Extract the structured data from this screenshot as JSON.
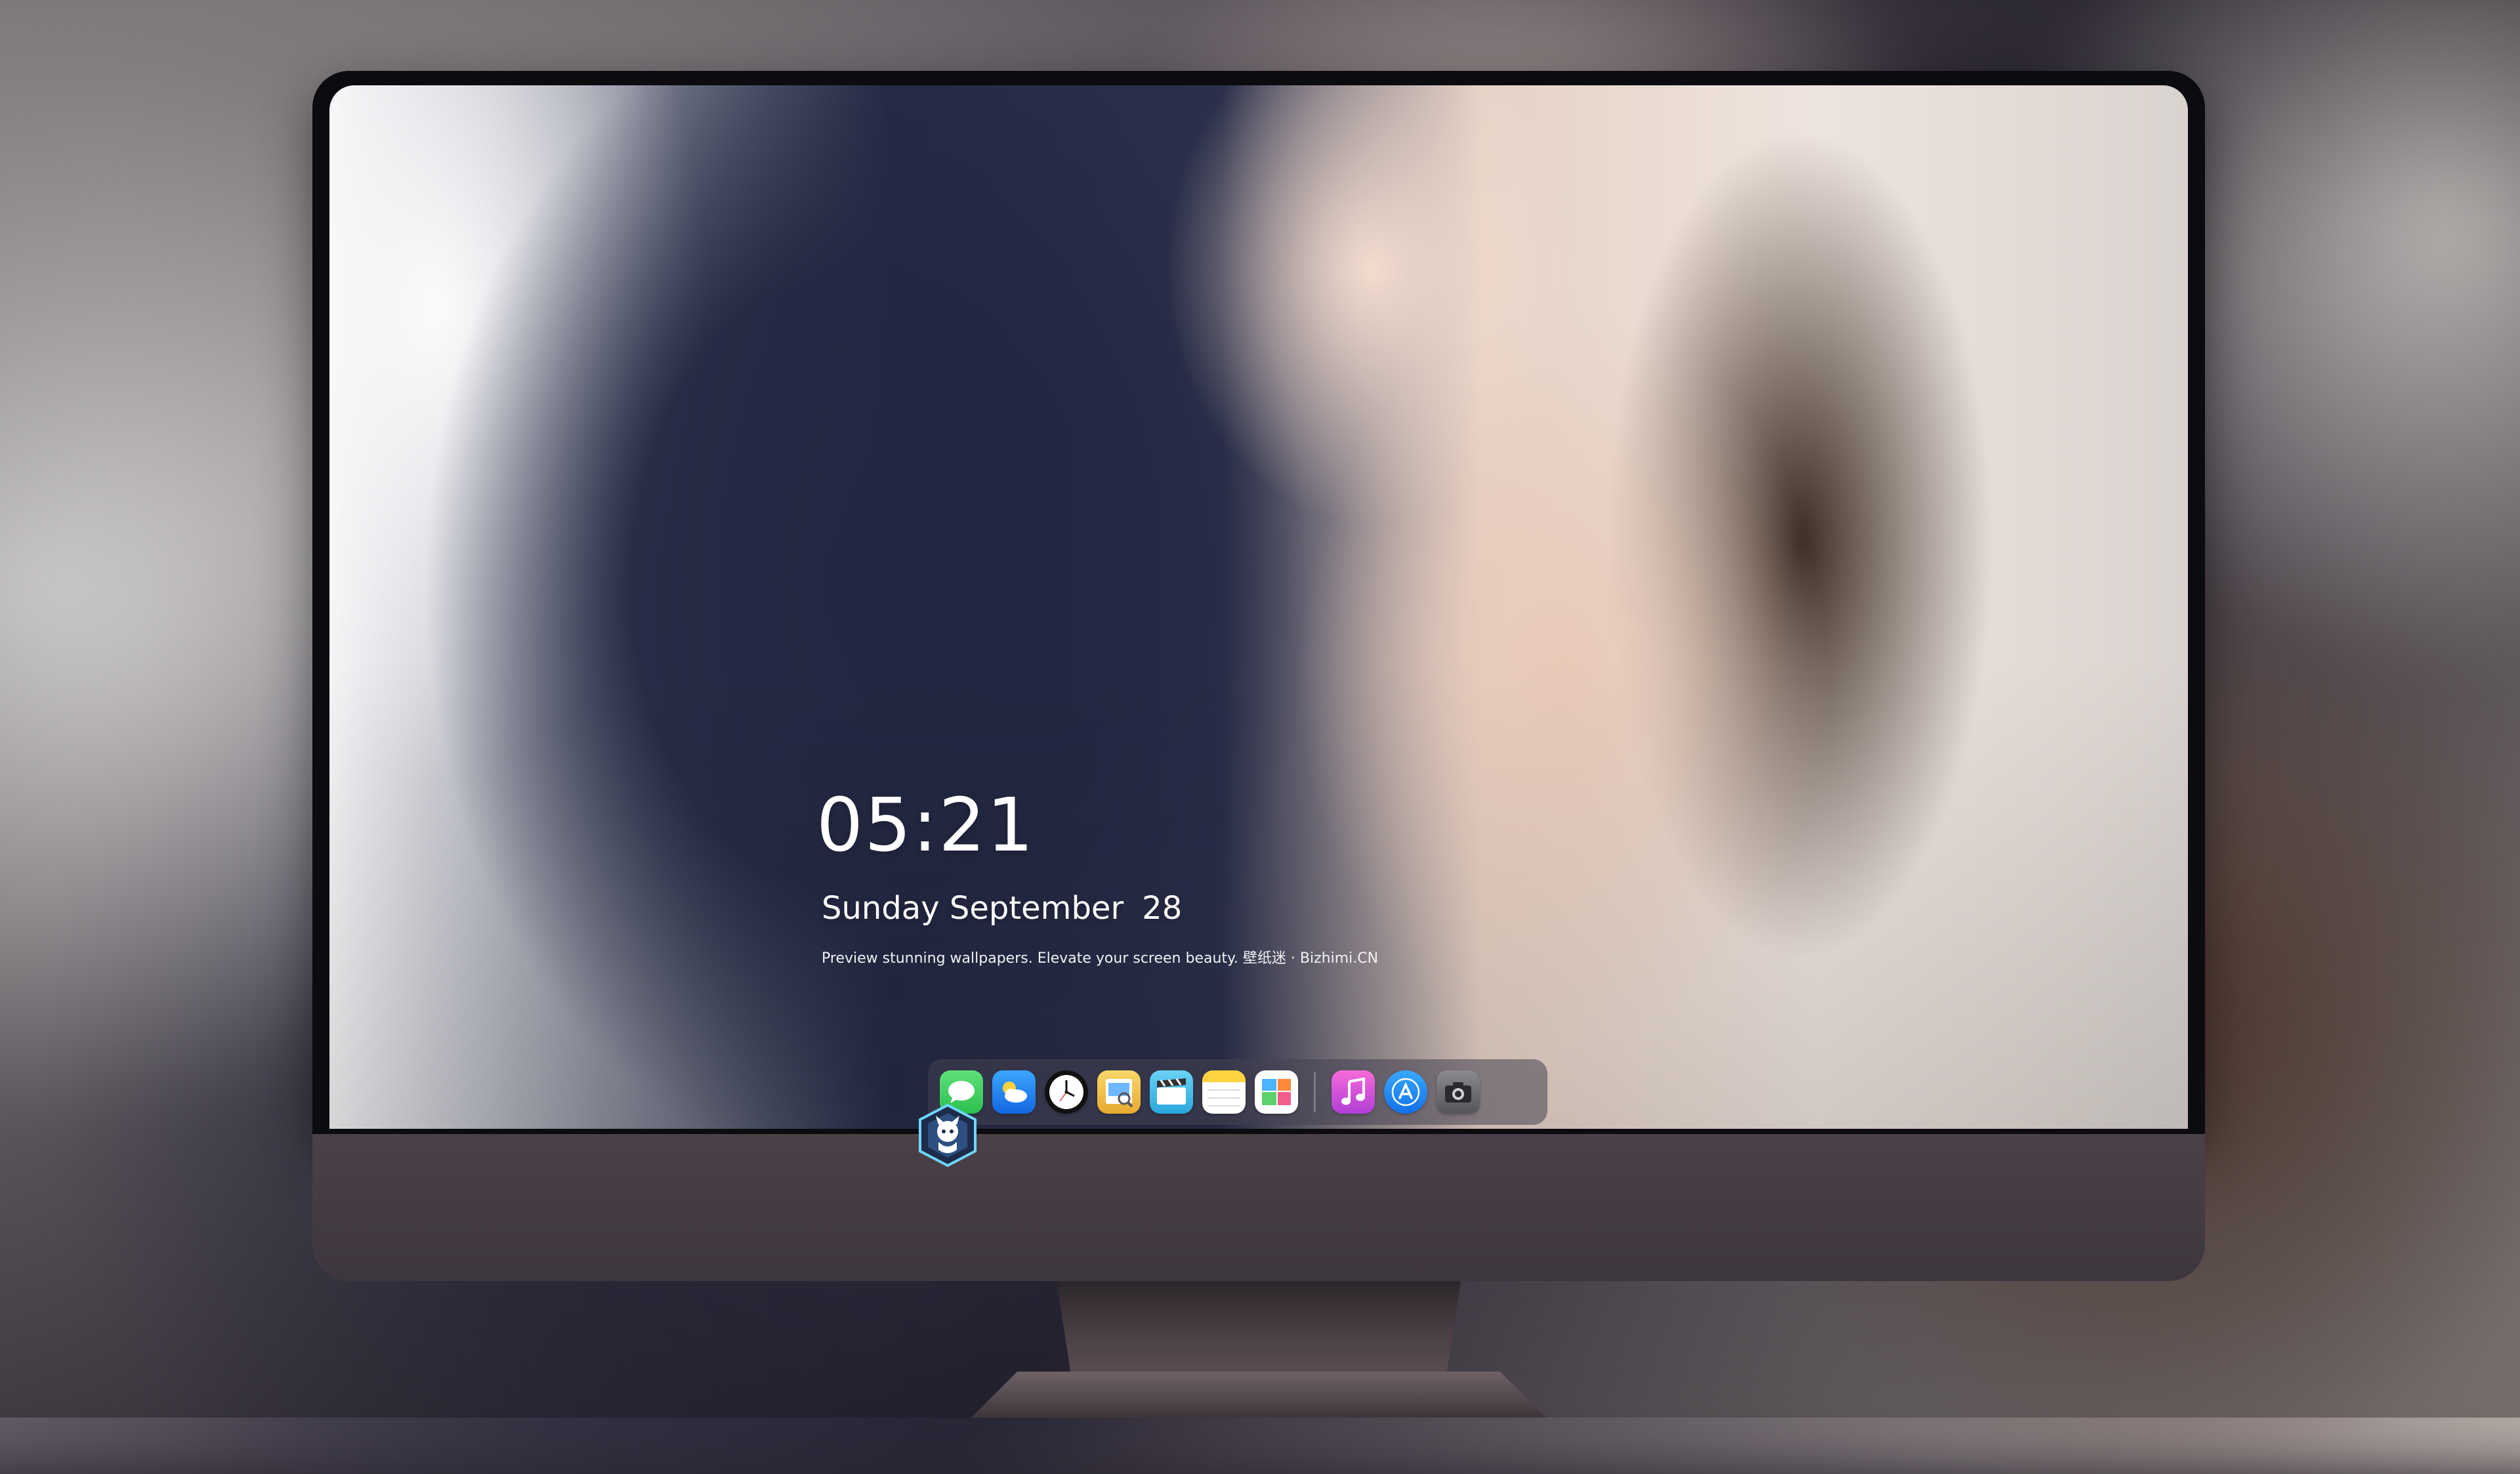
{
  "lockscreen": {
    "time": "05:21",
    "date_text": "Sunday September",
    "day_number": "28",
    "tagline": "Preview stunning wallpapers. Elevate your screen beauty. 壁纸迷 · Bizhimi.CN"
  },
  "dock": {
    "apps": [
      {
        "name": "messages-icon",
        "color": "#34c759"
      },
      {
        "name": "weather-icon",
        "color": "#1f8bff"
      },
      {
        "name": "clock-icon",
        "color": "#111111"
      },
      {
        "name": "preview-icon",
        "color": "#f4c542"
      },
      {
        "name": "clapper-icon",
        "color": "#45c2f0"
      },
      {
        "name": "notes-icon",
        "color": "#ffd54a"
      },
      {
        "name": "photo-gallery-icon",
        "color": "#ffffff"
      },
      {
        "name": "music-icon",
        "color": "#e24bd3"
      },
      {
        "name": "app-store-icon",
        "color": "#1c8cff"
      },
      {
        "name": "camera-icon",
        "color": "#6d6d72"
      }
    ]
  },
  "colors": {
    "bezel": "#0c0b10",
    "chin": "#4a4048",
    "dock_bg": "#464252"
  }
}
